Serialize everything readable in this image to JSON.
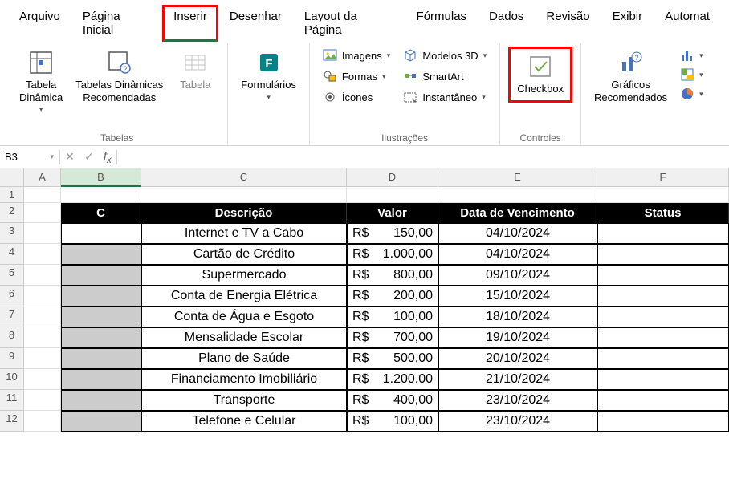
{
  "menus": [
    "Arquivo",
    "Página Inicial",
    "Inserir",
    "Desenhar",
    "Layout da Página",
    "Fórmulas",
    "Dados",
    "Revisão",
    "Exibir",
    "Automat"
  ],
  "active_menu_index": 2,
  "highlighted_menu_index": 2,
  "ribbon": {
    "group_tables": {
      "label": "Tabelas",
      "btn_dyn_table": "Tabela\nDinâmica",
      "btn_recommended": "Tabelas Dinâmicas\nRecomendadas",
      "btn_table": "Tabela"
    },
    "btn_forms": "Formulários",
    "group_illustrations": {
      "label": "Ilustrações",
      "btn_images": "Imagens",
      "btn_shapes": "Formas",
      "btn_icons": "Ícones",
      "btn_3d": "Modelos 3D",
      "btn_smartart": "SmartArt",
      "btn_snapshot": "Instantâneo"
    },
    "group_controls": {
      "label": "Controles",
      "btn_checkbox": "Checkbox"
    },
    "group_charts": {
      "btn_recommended_charts": "Gráficos\nRecomendados"
    }
  },
  "formula_bar": {
    "name_box": "B3",
    "formula": ""
  },
  "columns": [
    "A",
    "B",
    "C",
    "D",
    "E",
    "F"
  ],
  "rows": [
    "1",
    "2",
    "3",
    "4",
    "5",
    "6",
    "7",
    "8",
    "9",
    "10",
    "11",
    "12"
  ],
  "table": {
    "headers": {
      "c": "C",
      "desc": "Descrição",
      "valor": "Valor",
      "data": "Data de Vencimento",
      "status": "Status"
    },
    "currency": "R$",
    "rows": [
      {
        "desc": "Internet e TV a Cabo",
        "valor": "150,00",
        "data": "04/10/2024"
      },
      {
        "desc": "Cartão de Crédito",
        "valor": "1.000,00",
        "data": "04/10/2024"
      },
      {
        "desc": "Supermercado",
        "valor": "800,00",
        "data": "09/10/2024"
      },
      {
        "desc": "Conta de Energia Elétrica",
        "valor": "200,00",
        "data": "15/10/2024"
      },
      {
        "desc": "Conta de Água e Esgoto",
        "valor": "100,00",
        "data": "18/10/2024"
      },
      {
        "desc": "Mensalidade Escolar",
        "valor": "700,00",
        "data": "19/10/2024"
      },
      {
        "desc": "Plano de Saúde",
        "valor": "500,00",
        "data": "20/10/2024"
      },
      {
        "desc": "Financiamento Imobiliário",
        "valor": "1.200,00",
        "data": "21/10/2024"
      },
      {
        "desc": "Transporte",
        "valor": "400,00",
        "data": "23/10/2024"
      },
      {
        "desc": "Telefone e Celular",
        "valor": "100,00",
        "data": "23/10/2024"
      }
    ]
  }
}
